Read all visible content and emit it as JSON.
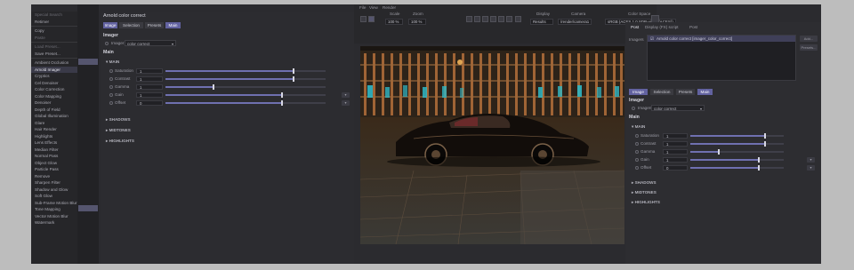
{
  "left_menu": {
    "items": [
      {
        "label": "Special Search",
        "state": "dim"
      },
      {
        "label": "Retimer",
        "state": ""
      },
      {
        "sep": true
      },
      {
        "label": "Copy",
        "state": ""
      },
      {
        "label": "Paste",
        "state": "dim"
      },
      {
        "sep": true
      },
      {
        "label": "Load Preset...",
        "state": "dim"
      },
      {
        "label": "Save Preset...",
        "state": ""
      },
      {
        "sep": true
      },
      {
        "label": "Ambient Occlusion",
        "state": ""
      },
      {
        "label": "Arnold Imager",
        "state": "active"
      },
      {
        "label": "Cryptics",
        "state": ""
      },
      {
        "label": "Cel Denoiser",
        "state": ""
      },
      {
        "label": "Color Correction",
        "state": ""
      },
      {
        "label": "Color Mapping",
        "state": ""
      },
      {
        "label": "Denoiser",
        "state": ""
      },
      {
        "label": "Depth of Field",
        "state": ""
      },
      {
        "label": "Global Illumination",
        "state": ""
      },
      {
        "label": "Glare",
        "state": ""
      },
      {
        "label": "Hair Render",
        "state": ""
      },
      {
        "label": "Highlights",
        "state": ""
      },
      {
        "label": "Lens Effects",
        "state": ""
      },
      {
        "label": "Median Filter",
        "state": ""
      },
      {
        "label": "Normal Pass",
        "state": ""
      },
      {
        "label": "Object Glow",
        "state": ""
      },
      {
        "label": "Particle Pass",
        "state": ""
      },
      {
        "label": "Remove",
        "state": ""
      },
      {
        "label": "Sharpen Filter",
        "state": ""
      },
      {
        "label": "Shadow and Glow",
        "state": ""
      },
      {
        "label": "Soft Glow",
        "state": ""
      },
      {
        "label": "Sub-Frame Motion Blur",
        "state": ""
      },
      {
        "label": "Tone Mapping",
        "state": ""
      },
      {
        "label": "Vector Motion Blur",
        "state": ""
      },
      {
        "label": "Watermark",
        "state": ""
      }
    ]
  },
  "editor": {
    "title": "Arnold color correct",
    "tabs": [
      {
        "label": "Image",
        "selected": true
      },
      {
        "label": "Selection",
        "selected": false
      },
      {
        "label": "Presets",
        "selected": false
      },
      {
        "label": "Main",
        "selected": true
      }
    ],
    "imager_heading": "Imager",
    "imager_label": "Imager",
    "imager_value": "color correct",
    "main_heading": "Main",
    "group_main": "MAIN",
    "params": [
      {
        "label": "Saturation",
        "value": "1",
        "level": 0.8
      },
      {
        "label": "Contrast",
        "value": "1",
        "level": 0.8
      },
      {
        "label": "Gamma",
        "value": "1",
        "level": 0.3
      },
      {
        "label": "Gain",
        "value": "1",
        "level": 0.73
      },
      {
        "label": "Offset",
        "value": "0",
        "level": 0.73
      }
    ],
    "collapsed": [
      "SHADOWS",
      "MIDTONES",
      "HIGHLIGHTS"
    ]
  },
  "toolbar": {
    "menus": [
      "File",
      "View",
      "Render"
    ],
    "scale_label": "Scale",
    "scale_value": "100 %",
    "zoom_label": "Zoom",
    "zoom_value": "100 %",
    "display_label": "Display",
    "display_value": "Results",
    "camera_label": "Camera",
    "camera_value": "/render/camera1",
    "colorspace_label": "Color Space",
    "colorspace_value": "sRGB (ACES 1.0 SDR-video (ACES))"
  },
  "right_panel": {
    "tabs": [
      "Post",
      "Display (FX) script",
      "Post"
    ],
    "imagers_label": "Imagers",
    "imager_item": "Arnold color correct [imager_color_correct]",
    "add_label": "Add...",
    "presets_label": "Presets...",
    "sub_tabs": [
      {
        "label": "Image",
        "selected": true
      },
      {
        "label": "Selection",
        "selected": false
      },
      {
        "label": "Presets",
        "selected": false
      },
      {
        "label": "Main",
        "selected": true
      }
    ],
    "imager_heading": "Imager",
    "imager_label": "Imagers",
    "imager_value": "color correct",
    "main_heading": "Main",
    "group_main": "MAIN",
    "params": [
      {
        "label": "Saturation",
        "value": "1",
        "level": 0.8
      },
      {
        "label": "Contrast",
        "value": "1",
        "level": 0.8
      },
      {
        "label": "Gamma",
        "value": "1",
        "level": 0.3
      },
      {
        "label": "Gain",
        "value": "1",
        "level": 0.73
      },
      {
        "label": "Offset",
        "value": "0",
        "level": 0.73
      }
    ],
    "collapsed": [
      "SHADOWS",
      "MIDTONES",
      "HIGHLIGHTS"
    ]
  },
  "colors": {
    "accent": "#6262a0",
    "slider": "#6f70b0",
    "background": "#2b2b2f"
  }
}
